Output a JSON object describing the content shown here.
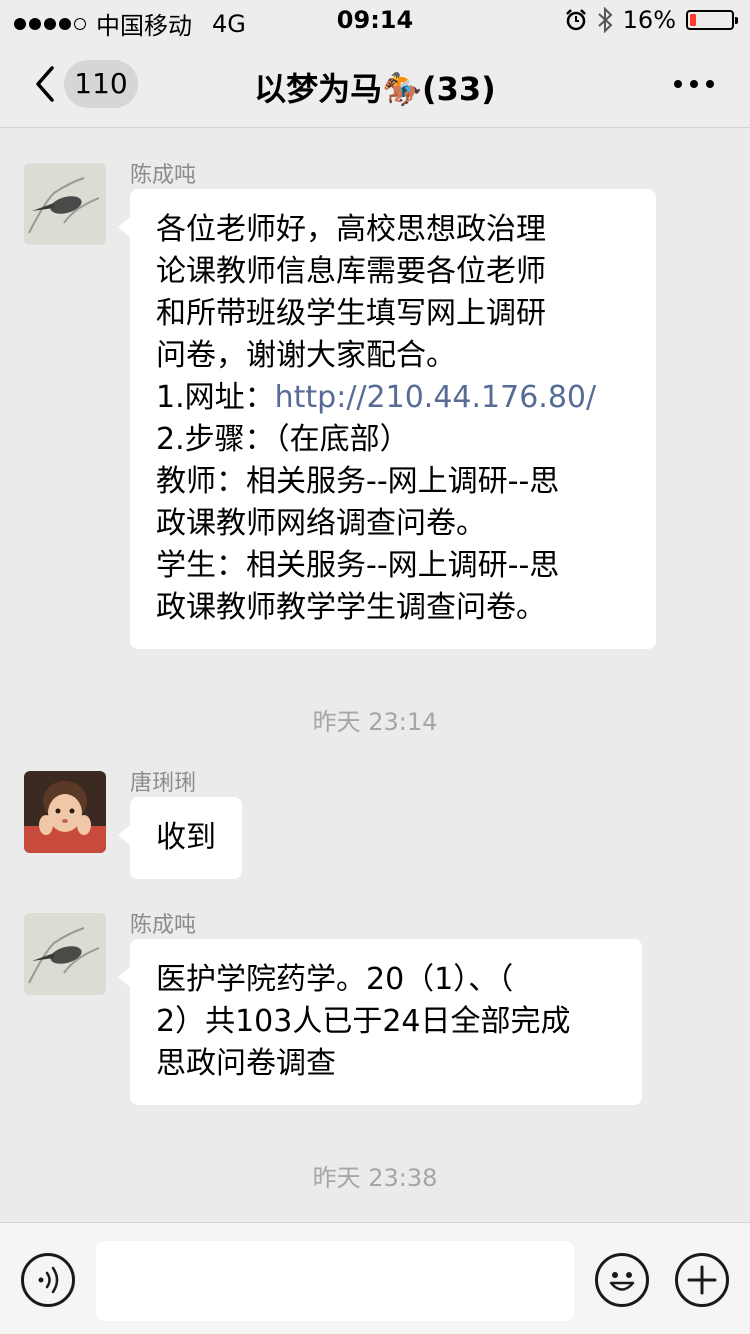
{
  "status_bar": {
    "carrier": "中国移动",
    "network": "4G",
    "time": "09:14",
    "battery": "16%",
    "battery_level": 0.16,
    "battery_color": "#ff3b30"
  },
  "nav": {
    "unread_count": "110",
    "title": "以梦为马🏇(33)",
    "back_icon": "chevron-left-icon",
    "more_icon": "ellipsis-icon"
  },
  "messages": [
    {
      "sender": "陈成吨",
      "lines": [
        "各位老师好，高校思想政治理",
        "论课教师信息库需要各位老师",
        "和所带班级学生填写网上调研",
        "问卷，谢谢大家配合。"
      ],
      "url_prefix": "1.网址：",
      "url": "http://210.44.176.80/",
      "lines_after": [
        "2.步骤：（在底部）",
        "教师：相关服务--网上调研--思",
        "政课教师网络调查问卷。",
        "学生：相关服务--网上调研--思",
        "政课教师教学学生调查问卷。"
      ]
    },
    {
      "sender": "唐琍琍",
      "lines": [
        "收到"
      ]
    },
    {
      "sender": "陈成吨",
      "lines": [
        "医护学院药学。20（1）、（",
        "2）共103人已于24日全部完成",
        "思政问卷调查"
      ]
    }
  ],
  "timestamps": [
    "昨天 23:14",
    "昨天 23:38"
  ],
  "input_bar": {
    "voice_icon": "voice-icon",
    "emoji_icon": "emoji-icon",
    "plus_icon": "plus-icon"
  }
}
